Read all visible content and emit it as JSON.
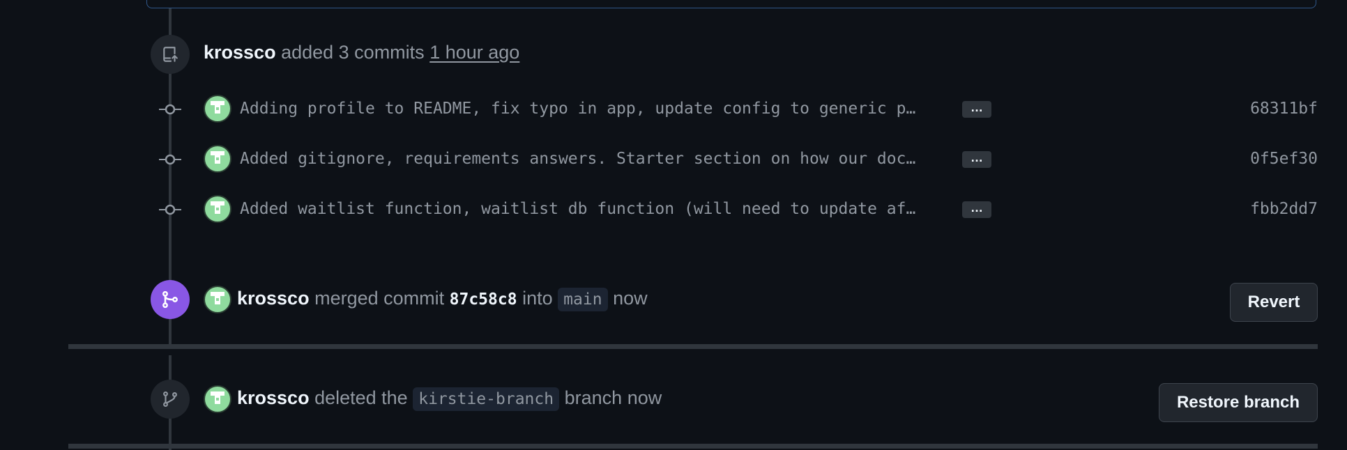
{
  "push_event": {
    "user": "krossco",
    "action": "added 3 commits",
    "time": "1 hour ago"
  },
  "commits": [
    {
      "message": "Adding profile to README, fix typo in app, update config to generic p…",
      "sha": "68311bf",
      "more": "…"
    },
    {
      "message": "Added gitignore, requirements answers. Starter section on how our doc…",
      "sha": "0f5ef30",
      "more": "…"
    },
    {
      "message": "Added waitlist function, waitlist db function (will need to update af…",
      "sha": "fbb2dd7",
      "more": "…"
    }
  ],
  "merge_event": {
    "user": "krossco",
    "text1": "merged commit",
    "sha": "87c58c8",
    "text2": "into",
    "branch": "main",
    "time": "now",
    "button": "Revert"
  },
  "delete_event": {
    "user": "krossco",
    "text1": "deleted the",
    "branch": "kirstie-branch",
    "text2": "branch",
    "time": "now",
    "button": "Restore branch"
  },
  "colors": {
    "background": "#0d1117",
    "merge_badge": "#8957e5",
    "avatar": "#8fdb9e"
  },
  "icons": [
    "repo-push-icon",
    "git-commit-icon",
    "git-merge-icon",
    "git-branch-icon"
  ]
}
